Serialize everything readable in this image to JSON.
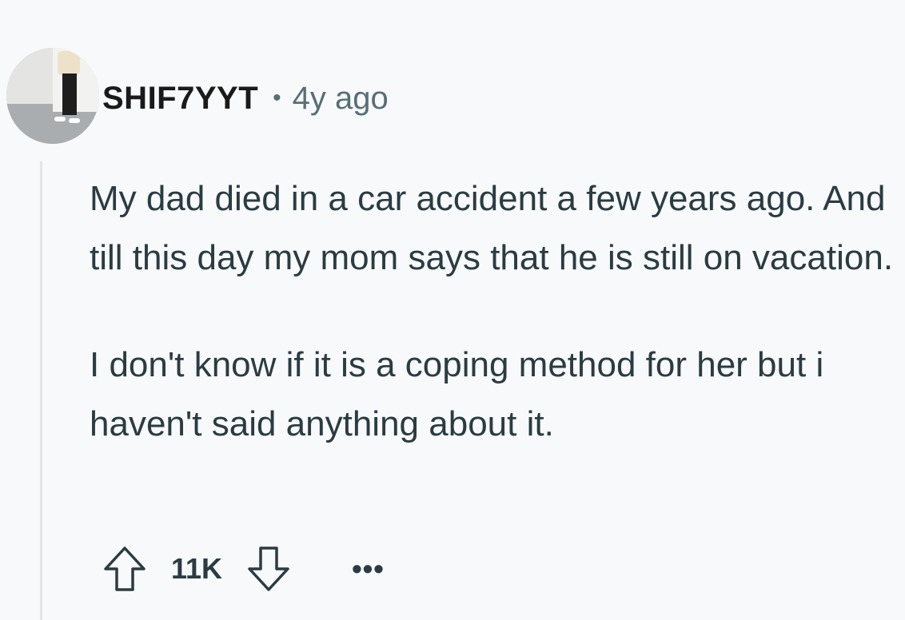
{
  "comment": {
    "author": "SHIF7YYT",
    "separator": "•",
    "timestamp": "4y ago",
    "paragraphs": [
      "My dad died in a car accident a few years ago. And till this day my mom says that he is still on vacation.",
      "I don't know if it is a coping method for her but i haven't said anything about it."
    ],
    "score": "11K",
    "more_label": "•••"
  },
  "icons": {
    "upvote": "upvote-arrow-icon",
    "downvote": "downvote-arrow-icon",
    "more": "overflow-menu-icon"
  },
  "colors": {
    "background": "#f8f9fb",
    "text": "#2a3c42",
    "meta": "#576f76",
    "thread_line": "#e3e6e9"
  }
}
